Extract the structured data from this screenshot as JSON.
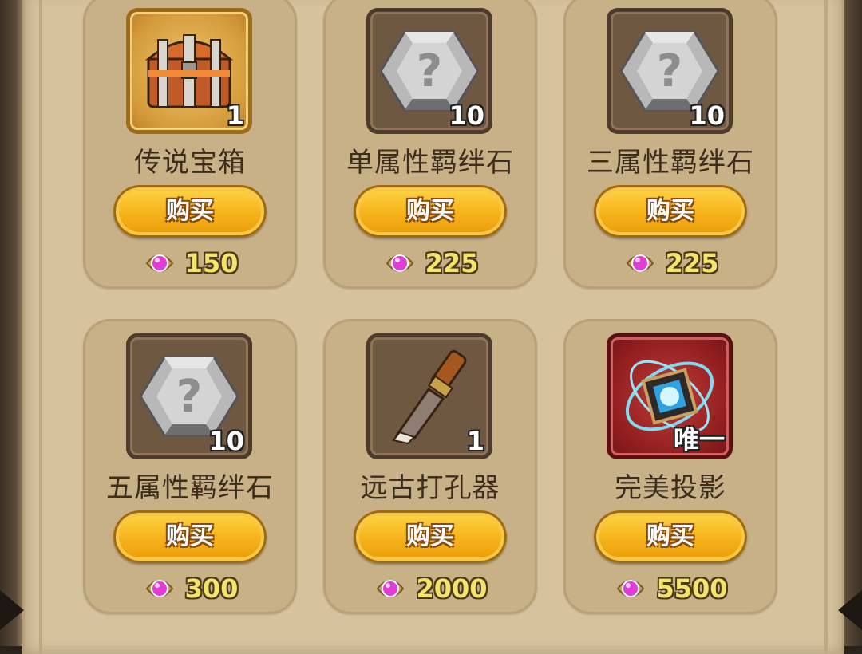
{
  "shop": {
    "items": [
      {
        "name": "传说宝箱",
        "qty": "1",
        "buy_label": "购买",
        "price": "150",
        "icon": "treasure-chest-icon"
      },
      {
        "name": "单属性羁绊石",
        "qty": "10",
        "buy_label": "购买",
        "price": "225",
        "icon": "mystery-gem-icon"
      },
      {
        "name": "三属性羁绊石",
        "qty": "10",
        "buy_label": "购买",
        "price": "225",
        "icon": "mystery-gem-icon"
      },
      {
        "name": "五属性羁绊石",
        "qty": "10",
        "buy_label": "购买",
        "price": "300",
        "icon": "mystery-gem-icon"
      },
      {
        "name": "远古打孔器",
        "qty": "1",
        "buy_label": "购买",
        "price": "2000",
        "icon": "chisel-icon"
      },
      {
        "name": "完美投影",
        "qty": "唯一",
        "buy_label": "购买",
        "price": "5500",
        "icon": "magic-cube-icon"
      }
    ],
    "currency_icon": "diamond-currency-icon",
    "colors": {
      "button": "#f6b21a",
      "price": "#f5e46a",
      "card": "#c8b087"
    }
  }
}
